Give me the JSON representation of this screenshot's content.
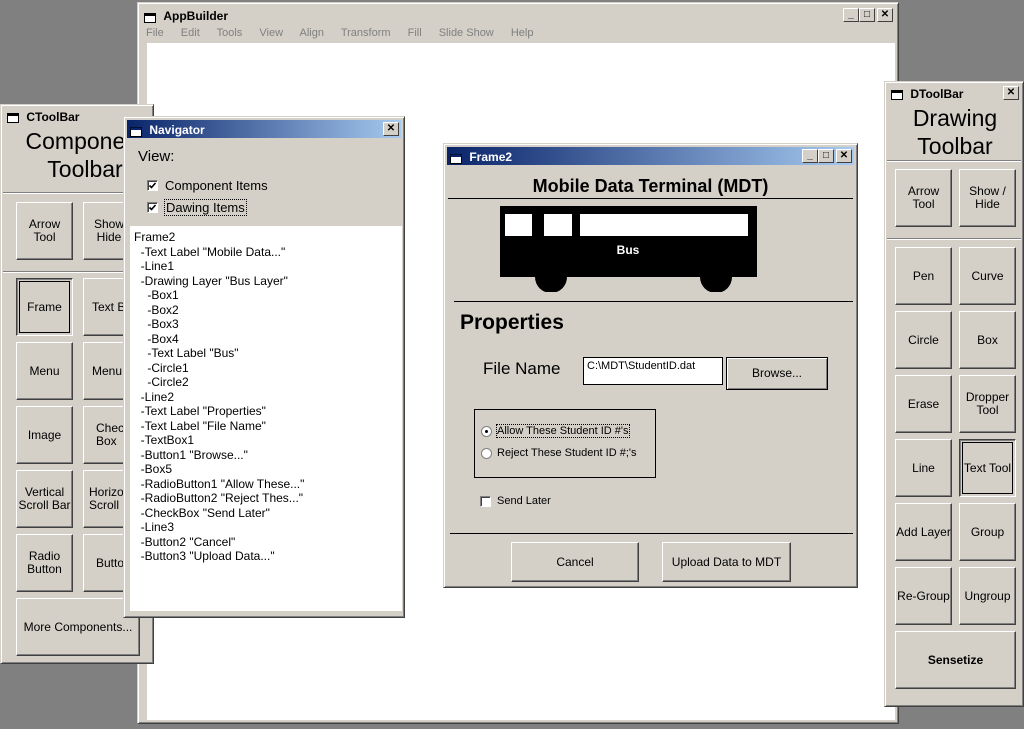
{
  "appbuilder": {
    "title": "AppBuilder",
    "menu": [
      "File",
      "Edit",
      "Tools",
      "View",
      "Align",
      "Transform",
      "Fill",
      "Slide Show",
      "Help"
    ]
  },
  "ctoolbar": {
    "title": "CToolBar",
    "heading_line1": "Component",
    "heading_line2": "Toolbar",
    "buttons": {
      "arrow": "Arrow\nTool",
      "showhide": "Show\nHide",
      "frame": "Frame",
      "textbox": "Text B",
      "menu": "Menu",
      "menubar": "Menu B",
      "image": "Image",
      "checkbox": "Check\nBox",
      "vscroll": "Vertical\nScroll Bar",
      "hscroll": "Horizo\nScroll B",
      "radio": "Radio\nButton",
      "button": "Butto",
      "more": "More Components..."
    }
  },
  "navigator": {
    "title": "Navigator",
    "view_label": "View:",
    "component_items": "Component Items",
    "drawing_items": "Dawing Items",
    "tree": [
      "Frame2",
      "  -Text Label \"Mobile Data...\"",
      "  -Line1",
      "  -Drawing Layer \"Bus Layer\"",
      "    -Box1",
      "    -Box2",
      "    -Box3",
      "    -Box4",
      "    -Text Label \"Bus\"",
      "    -Circle1",
      "    -Circle2",
      "  -Line2",
      "  -Text Label \"Properties\"",
      "  -Text Label \"File Name\"",
      "  -TextBox1",
      "  -Button1 \"Browse...\"",
      "  -Box5",
      "  -RadioButton1 \"Allow These...\"",
      "  -RadioButton2 \"Reject Thes...\"",
      "  -CheckBox \"Send Later\"",
      "  -Line3",
      "  -Button2 \"Cancel\"",
      "  -Button3 \"Upload Data...\""
    ]
  },
  "frame2": {
    "title": "Frame2",
    "heading": "Mobile Data Terminal (MDT)",
    "bus_label": "Bus",
    "properties": "Properties",
    "file_name_label": "File Name",
    "file_name_value": "C:\\MDT\\StudentID.dat",
    "browse": "Browse...",
    "radio_allow": "Allow These Student ID #'s",
    "radio_reject": "Reject These Student ID #;'s",
    "send_later": "Send Later",
    "cancel": "Cancel",
    "upload": "Upload Data to MDT"
  },
  "dtoolbar": {
    "title": "DToolBar",
    "heading_line1": "Drawing",
    "heading_line2": "Toolbar",
    "buttons": {
      "arrow": "Arrow\nTool",
      "showhide": "Show /\nHide",
      "pen": "Pen",
      "curve": "Curve",
      "circle": "Circle",
      "box": "Box",
      "erase": "Erase",
      "dropper": "Dropper\nTool",
      "line": "Line",
      "text": "Text Tool",
      "addlayer": "Add Layer",
      "group": "Group",
      "regroup": "Re-Group",
      "ungroup": "Ungroup",
      "sensetize": "Sensetize"
    }
  },
  "window_buttons": {
    "minimize": "_",
    "maximize": "□",
    "close": "✕"
  }
}
